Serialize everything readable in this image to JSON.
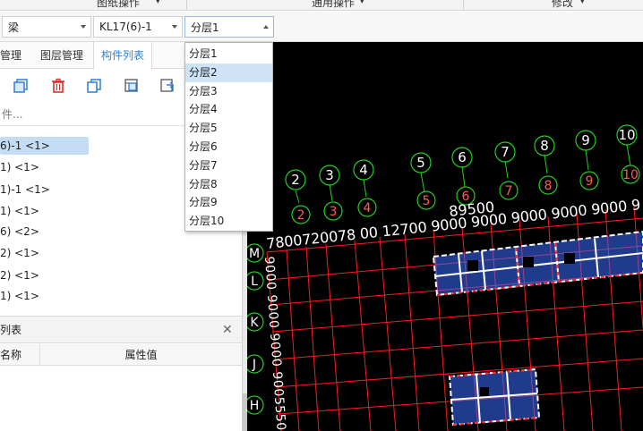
{
  "ribbon": {
    "groups": [
      "图纸操作",
      "通用操作",
      "修改"
    ]
  },
  "combos": {
    "category": "梁",
    "component": "KL17(6)-1",
    "floor": "分层1"
  },
  "floor_dropdown": {
    "options": [
      "分层1",
      "分层2",
      "分层3",
      "分层4",
      "分层5",
      "分层6",
      "分层7",
      "分层8",
      "分层9",
      "分层10"
    ],
    "selected_index": 1
  },
  "left_panel": {
    "tabs": [
      "管理",
      "图层管理",
      "构件列表"
    ],
    "active_tab": "构件列表",
    "toolbar_icons": [
      "new-icon",
      "delete-icon",
      "copy-icon",
      "layer-copy-icon",
      "floor-copy-icon"
    ],
    "search_placeholder": "件...",
    "list_items": [
      "6)-1 <1>",
      "1) <1>",
      "1)-1 <1>",
      "1) <1>",
      "6) <2>",
      "2) <1>",
      "2) <1>",
      "1) <1>"
    ],
    "selected_item": 0
  },
  "props_panel": {
    "title": "列表",
    "col_name": "名称",
    "col_value": "属性值"
  },
  "cad": {
    "axis_top_circles": [
      "2",
      "3",
      "4",
      "5",
      "6",
      "7",
      "8",
      "9",
      "10"
    ],
    "axis_inner_circles": [
      "2",
      "3",
      "4",
      "5",
      "6",
      "7",
      "8",
      "9",
      "10"
    ],
    "dimension_text": "7800720078 00 12700 9000 9000 9000 9000 9000 9",
    "dimension_total": "89500",
    "axis_left_circles": [
      "M",
      "L",
      "K",
      "J",
      "H"
    ],
    "left_dimension_text": "9000 9000 9000 9005550",
    "colors": {
      "grid": "#ff0000",
      "axis": "#ffffff",
      "circle": "#20d020",
      "highlight": "#3a6cff"
    }
  }
}
